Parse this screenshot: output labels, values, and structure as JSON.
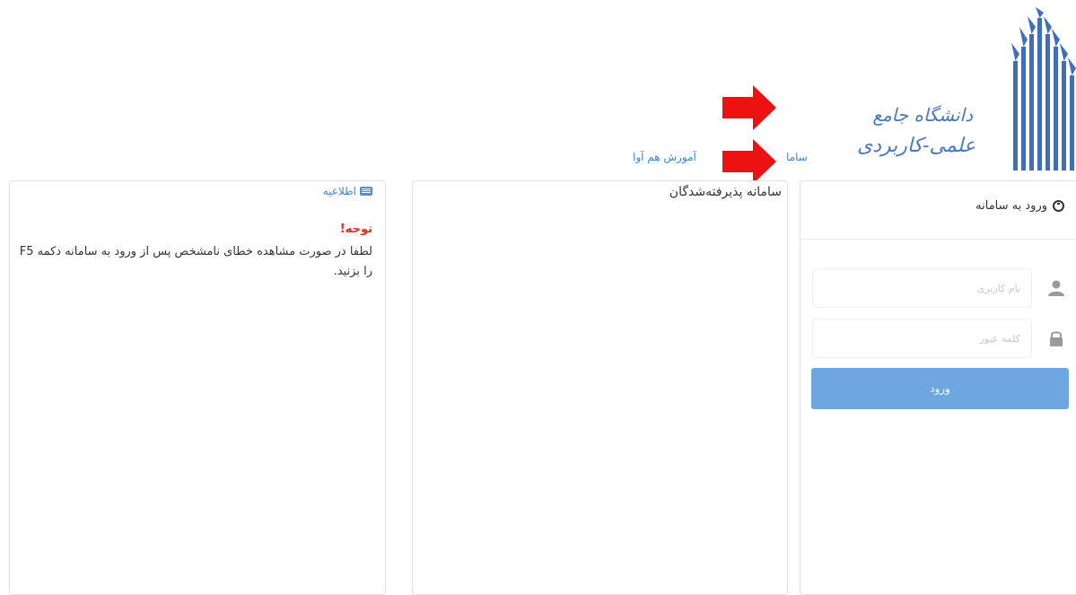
{
  "logo": {
    "line1": "دانشگاه جامع",
    "line2": "علمی-کاربردی",
    "color": "#3f6fba"
  },
  "top_links": {
    "sama": "ساما",
    "hamava": "آموزش هم آوا"
  },
  "info_panel": {
    "title": "اطلاعیه",
    "attention": "توجه!",
    "body": "لطفا در صورت مشاهده خطای نامشخص پس از ورود به سامانه دکمه F5 را بزنید."
  },
  "middle_panel": {
    "title": "سامانه پذیرفته‌شدگان"
  },
  "login": {
    "title": "ورود به سامانه",
    "username_placeholder": "نام کاربری",
    "password_placeholder": "کلمه عبور",
    "submit_label": "ورود"
  },
  "colors": {
    "accent": "#3f86d9",
    "button": "#6ea7e0",
    "alert": "#e8281e",
    "arrow": "#ee1111"
  }
}
